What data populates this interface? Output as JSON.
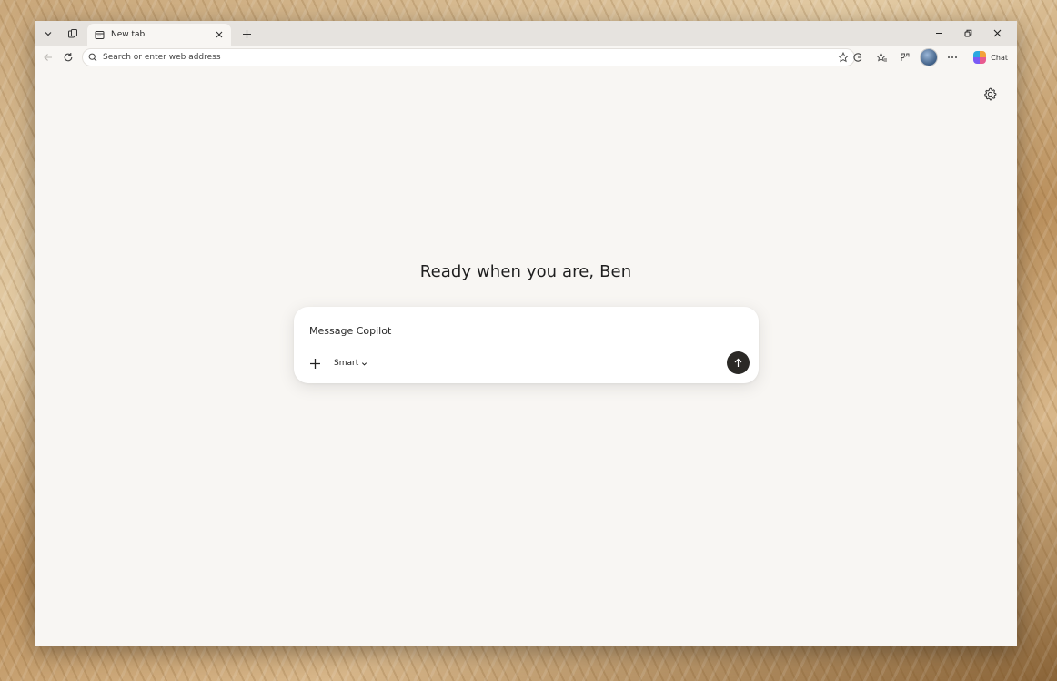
{
  "tabstrip": {
    "tab": {
      "title": "New tab"
    }
  },
  "toolbar": {
    "address_placeholder": "Search or enter web address",
    "chat_label": "Chat"
  },
  "page": {
    "greeting": "Ready when you are, Ben",
    "composer": {
      "placeholder": "Message Copilot",
      "mode_label": "Smart"
    }
  },
  "colors": {
    "window_bg": "#f8f6f3",
    "tabstrip_bg": "#e6e3df",
    "send_button": "#2b2926"
  },
  "icons": [
    "tab-actions-chevron-icon",
    "workspaces-icon",
    "tab-page-icon",
    "close-icon",
    "plus-icon",
    "minimize-icon",
    "restore-icon",
    "back-arrow-icon",
    "refresh-icon",
    "search-icon",
    "star-icon",
    "copilot-circle-icon",
    "favorites-icon",
    "extensions-icon",
    "more-icon",
    "settings-gear-icon",
    "send-arrow-icon"
  ]
}
